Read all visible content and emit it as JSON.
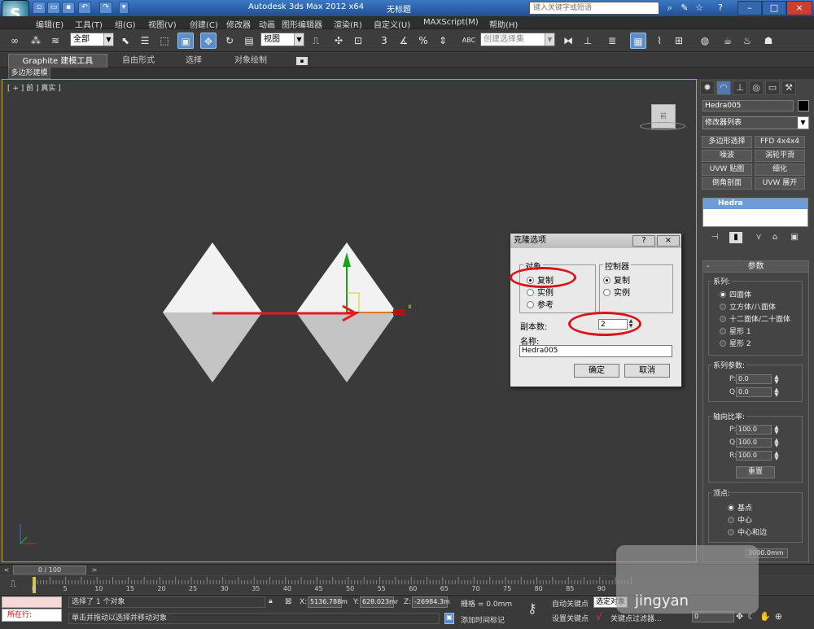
{
  "titlebar": {
    "title": "Autodesk 3ds Max  2012 x64",
    "filename": "无标题",
    "help_search_placeholder": "键入关键字或短语",
    "win_minimize": "–",
    "win_maximize": "□",
    "win_close": "×"
  },
  "menu": [
    "编辑(E)",
    "工具(T)",
    "组(G)",
    "视图(V)",
    "创建(C)",
    "修改器",
    "动画",
    "图形编辑器",
    "渲染(R)",
    "自定义(U)",
    "MAXScript(M)",
    "帮助(H)"
  ],
  "toolbar": {
    "filter_value": "全部",
    "ref_coord_value": "视图",
    "named_selection_value": "创建选择集",
    "snap_label": "3",
    "percent_snap_label": "%",
    "abc_label": "ABC"
  },
  "ribbon": {
    "tabs": [
      "Graphite 建模工具",
      "自由形式",
      "选择",
      "对象绘制"
    ],
    "sub_label": "多边形建模"
  },
  "viewport": {
    "label": "[ + ] 前 ] 真实 ]",
    "viewcube_label": "前",
    "axis_x_label": "x"
  },
  "dialog": {
    "title": "克隆选项",
    "help_btn": "?",
    "close_btn": "×",
    "object_group": "对象",
    "object_options": [
      "复制",
      "实例",
      "参考"
    ],
    "object_selected": 0,
    "controller_group": "控制器",
    "controller_options": [
      "复制",
      "实例"
    ],
    "controller_selected": 0,
    "copies_label": "副本数:",
    "copies_value": "2",
    "name_label": "名称:",
    "name_value": "Hedra005",
    "ok_label": "确定",
    "cancel_label": "取消"
  },
  "command_panel": {
    "object_name": "Hedra005",
    "modifier_list": "修改器列表",
    "modifier_buttons": [
      "多边形选择",
      "FFD 4x4x4",
      "噪波",
      "涡轮平滑",
      "UVW 贴图",
      "细化",
      "倒角剖面",
      "UVW 展开"
    ],
    "stack_item": "Hedra",
    "params_title": "参数",
    "family_title": "系列:",
    "family_options": [
      "四面体",
      "立方体/八面体",
      "十二面体/二十面体",
      "星形 1",
      "星形 2"
    ],
    "family_selected": 0,
    "family_params_title": "系列参数:",
    "p_label": "P:",
    "q_label": "Q:",
    "r_label": "R:",
    "family_p": "0.0",
    "family_q": "0.0",
    "axis_title": "轴向比率:",
    "axis_p": "100.0",
    "axis_q": "100.0",
    "axis_r": "100.0",
    "reset_label": "重置",
    "vertex_title": "顶点:",
    "vertex_options": [
      "基点",
      "中心",
      "中心和边"
    ],
    "vertex_selected": 0,
    "radius_value": "3000.0mm"
  },
  "timeline": {
    "frame_indicator": "0 / 100",
    "ticks": [
      "0",
      "5",
      "10",
      "15",
      "20",
      "25",
      "30",
      "35",
      "40",
      "45",
      "50",
      "55",
      "60",
      "65",
      "70",
      "75",
      "80",
      "85",
      "90"
    ]
  },
  "status": {
    "running_label": "所在行:",
    "selected_text": "选择了 1 个对象",
    "prompt_text": "单击并拖动以选择并移动对象",
    "x_label": "X:",
    "x_value": "5136.788m",
    "y_label": "Y:",
    "y_value": "628.023mr",
    "z_label": "Z:",
    "z_value": "-26984.3m",
    "grid_text": "栅格 = 0.0mm",
    "add_time_tag": "添加时间标记",
    "auto_key": "自动关键点",
    "set_key": "设置关键点",
    "selected_object": "选定对象",
    "key_filters": "关键点过滤器...",
    "frame_value": "0"
  },
  "watermark": "jingyan"
}
